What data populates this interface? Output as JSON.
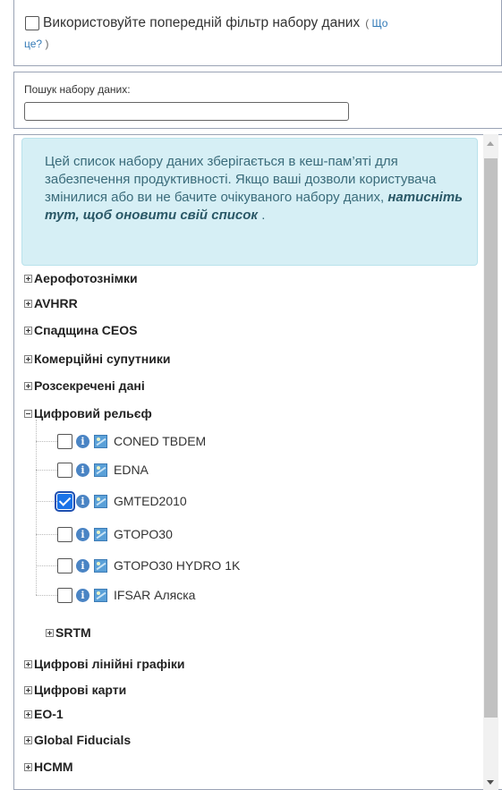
{
  "filter": {
    "label": "Використовуйте попередній фільтр набору даних",
    "help_open": "(",
    "help_link_part1": "Що",
    "help_link_part2": "це?",
    "help_close": ")",
    "checked": false
  },
  "search": {
    "label": "Пошук набору даних:",
    "value": "",
    "placeholder": ""
  },
  "notice": {
    "text": "Цей список набору даних зберігається в кеш-пам’яті для забезпечення продуктивності. Якщо ваші дозволи користувача змінилися або ви не бачите очікуваного набору даних,",
    "link": "натисніть тут, щоб оновити свій список",
    "suffix": "."
  },
  "tree": {
    "categories_top": [
      {
        "label": "Аерофотознімки",
        "expanded": false
      },
      {
        "label": "AVHRR",
        "expanded": false
      },
      {
        "label": "Спадщина CEOS",
        "expanded": false
      },
      {
        "label": "Комерційні супутники",
        "expanded": false
      },
      {
        "label": "Розсекречені дані",
        "expanded": false
      }
    ],
    "expanded_category": {
      "label": "Цифровий рельєф",
      "expanded": true
    },
    "datasets": [
      {
        "label": "CONED TBDEM",
        "checked": false
      },
      {
        "label": "EDNA",
        "checked": false
      },
      {
        "label": "GMTED2010",
        "checked": true
      },
      {
        "label": "GTOPO30",
        "checked": false
      },
      {
        "label": "GTOPO30 HYDRO 1K",
        "checked": false
      },
      {
        "label": "IFSAR Аляска",
        "checked": false
      }
    ],
    "subcategory": {
      "label": "SRTM",
      "expanded": false
    },
    "categories_bottom": [
      {
        "label": "Цифрові лінійні графіки",
        "expanded": false
      },
      {
        "label": "Цифрові карти",
        "expanded": false
      },
      {
        "label": "EO-1",
        "expanded": false
      },
      {
        "label": "Global Fiducials",
        "expanded": false
      },
      {
        "label": "HCMM",
        "expanded": false
      }
    ]
  },
  "icons": {
    "expand": "plus-box-icon",
    "collapse": "minus-box-icon",
    "info": "info-icon",
    "footprint": "map-footprint-icon"
  },
  "colors": {
    "notice_bg": "#d6eff5",
    "checkbox_checked": "#1a73e8",
    "info_icon": "#4a84c4"
  }
}
